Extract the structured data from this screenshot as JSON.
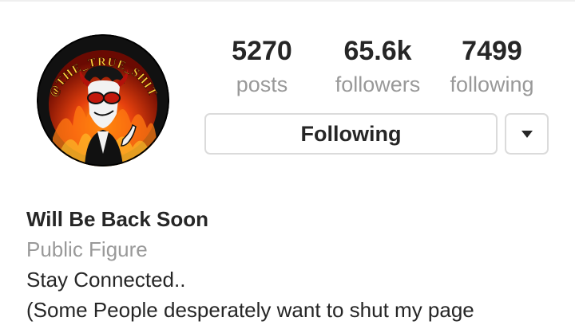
{
  "avatar": {
    "handle_text": "@THE_TRUE_SHIT",
    "border_color": "#000000",
    "fire_color": "#c41a0a"
  },
  "stats": {
    "posts": {
      "value": "5270",
      "label": "posts"
    },
    "followers": {
      "value": "65.6k",
      "label": "followers"
    },
    "following": {
      "value": "7499",
      "label": "following"
    }
  },
  "actions": {
    "following_label": "Following",
    "dropdown_icon": "caret-down-icon"
  },
  "bio": {
    "name": "Will Be Back Soon",
    "category": "Public Figure",
    "line1": "Stay Connected..",
    "line2": "(Some People desperately want to shut my page"
  }
}
